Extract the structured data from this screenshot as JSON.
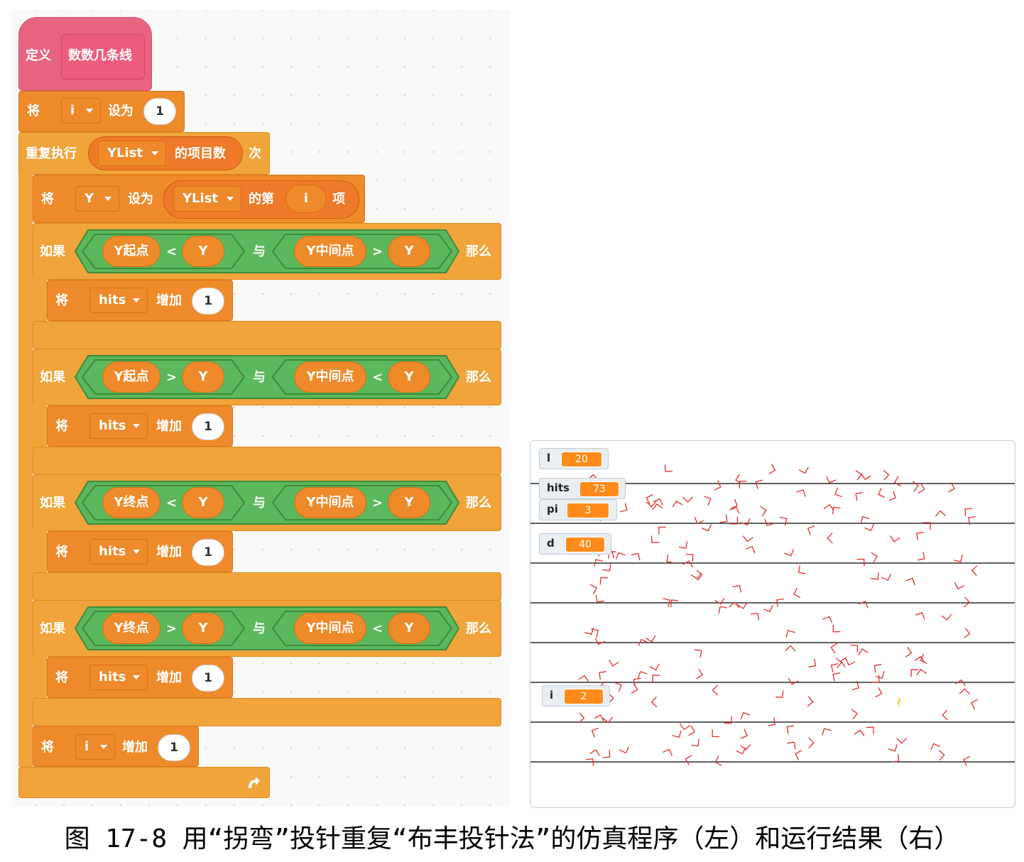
{
  "colors": {
    "define": "#e8637f",
    "control": "#f0a43a",
    "variable": "#ef8a2b",
    "operator": "#5cb85c",
    "pin": "#e03030"
  },
  "define": {
    "keyword": "定义",
    "name": "数数几条线"
  },
  "set_i": {
    "kw": "将",
    "var": "i",
    "kw2": "设为",
    "value": "1"
  },
  "repeat": {
    "kw": "重复执行",
    "list": "YList",
    "kw2": "的项目数",
    "kw3": "次",
    "loop_icon": "loop-arrow-icon"
  },
  "set_y": {
    "kw": "将",
    "var": "Y",
    "kw2": "设为",
    "list": "YList",
    "kw3": "的第",
    "index": "i",
    "kw4": "项"
  },
  "ifs": [
    {
      "kw": "如果",
      "a": "Y起点",
      "op1": "<",
      "b": "Y",
      "and": "与",
      "c": "Y中间点",
      "op2": ">",
      "d": "Y",
      "then": "那么",
      "change": {
        "kw": "将",
        "var": "hits",
        "kw2": "增加",
        "value": "1"
      }
    },
    {
      "kw": "如果",
      "a": "Y起点",
      "op1": ">",
      "b": "Y",
      "and": "与",
      "c": "Y中间点",
      "op2": "<",
      "d": "Y",
      "then": "那么",
      "change": {
        "kw": "将",
        "var": "hits",
        "kw2": "增加",
        "value": "1"
      }
    },
    {
      "kw": "如果",
      "a": "Y终点",
      "op1": "<",
      "b": "Y",
      "and": "与",
      "c": "Y中间点",
      "op2": ">",
      "d": "Y",
      "then": "那么",
      "change": {
        "kw": "将",
        "var": "hits",
        "kw2": "增加",
        "value": "1"
      }
    },
    {
      "kw": "如果",
      "a": "Y终点",
      "op1": ">",
      "b": "Y",
      "and": "与",
      "c": "Y中间点",
      "op2": "<",
      "d": "Y",
      "then": "那么",
      "change": {
        "kw": "将",
        "var": "hits",
        "kw2": "增加",
        "value": "1"
      }
    }
  ],
  "change_i": {
    "kw": "将",
    "var": "i",
    "kw2": "增加",
    "value": "1"
  },
  "monitors": {
    "l": {
      "label": "l",
      "value": "20"
    },
    "hits": {
      "label": "hits",
      "value": "73"
    },
    "pi": {
      "label": "pi",
      "value": "3"
    },
    "d": {
      "label": "d",
      "value": "40"
    },
    "i": {
      "label": "i",
      "value": "2"
    }
  },
  "caption": "图 17-8 用“拐弯”投针重复“布丰投针法”的仿真程序（左）和运行结果（右）"
}
